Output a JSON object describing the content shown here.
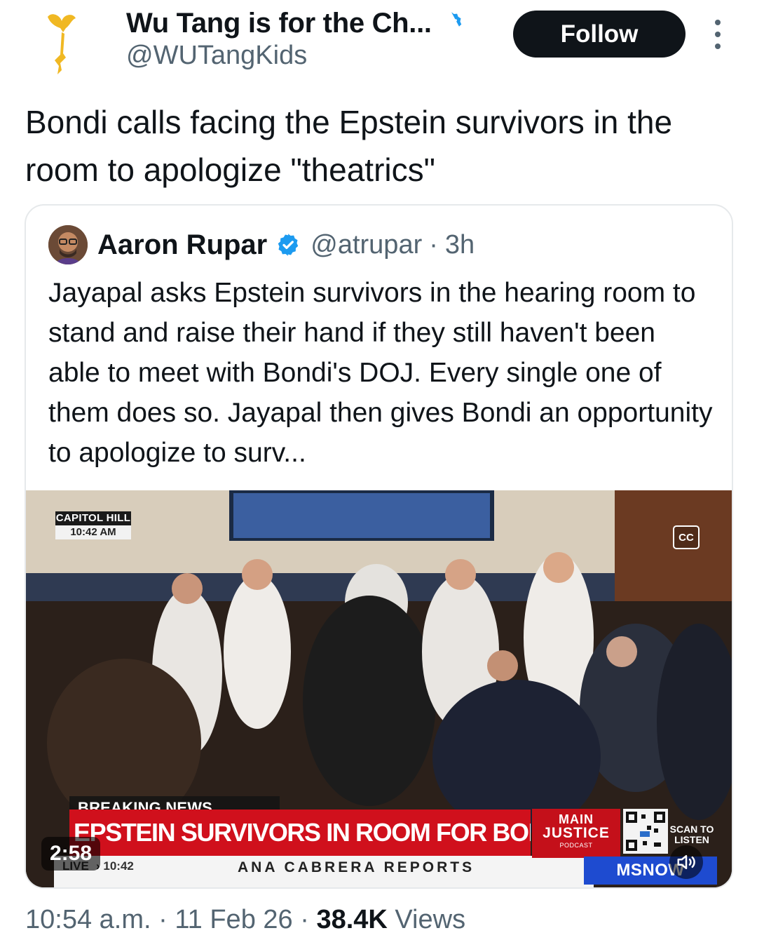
{
  "author": {
    "display_name": "Wu Tang is for the Ch...",
    "handle": "@WUTangKids",
    "verified": true,
    "avatar_icon": "wu-tang-logo-icon"
  },
  "follow_label": "Follow",
  "tweet": {
    "text": "Bondi calls facing the Epstein survivors in the room to apologize \"theatrics\""
  },
  "quoted": {
    "name": "Aaron Rupar",
    "verified": true,
    "handle": "@atrupar",
    "separator": "·",
    "time": "3h",
    "text": "Jayapal asks Epstein survivors in the hearing room to stand and raise their hand if they still haven't been able to meet with Bondi's DOJ. Every single one of them does so. Jayapal then gives Bondi an opportunity to apologize to surv...",
    "video": {
      "location_top": "CAPITOL HILL",
      "location_time": "10:42 AM",
      "cc_label": "CC",
      "breaking_label": "BREAKING NEWS",
      "headline": "EPSTEIN SURVIVORS IN ROOM FOR BONDI HEARING",
      "live_label": "LIVE",
      "ticker_time": "› 10:42",
      "reporter": "ANA CABRERA REPORTS",
      "show_line1": "MAIN",
      "show_line2": "JUSTICE",
      "show_line3": "PODCAST",
      "scan_text": "SCAN TO LISTEN",
      "network": "MSNOW",
      "duration": "2:58"
    }
  },
  "footer": {
    "time": "10:54 a.m.",
    "sep1": " · ",
    "date": "11 Feb 26",
    "sep2": " · ",
    "views_count": "38.4K",
    "views_label": " Views"
  },
  "colors": {
    "verified_blue": "#1d9bf0",
    "secondary_text": "#536471",
    "breaking_red": "#d0101c",
    "network_blue": "#1e4bd0"
  }
}
